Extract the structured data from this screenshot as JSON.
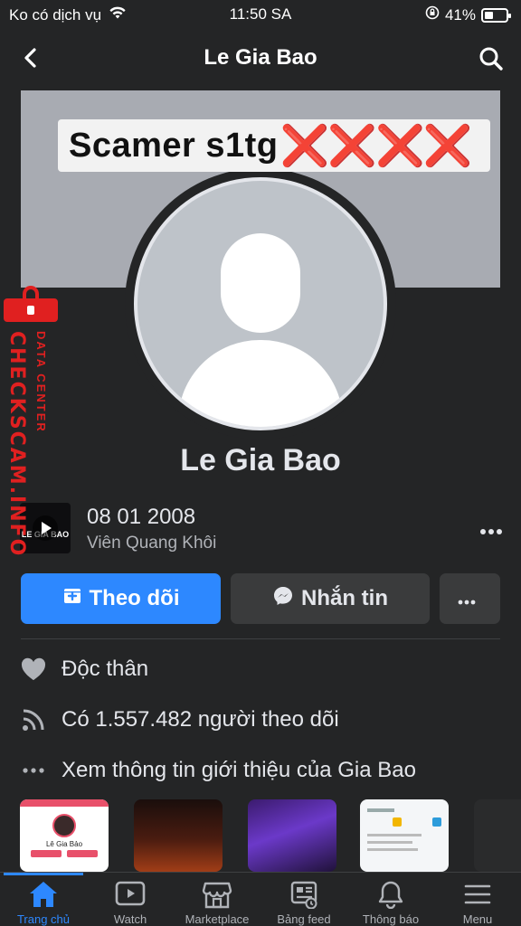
{
  "status_bar": {
    "carrier": "Ko có dịch vụ",
    "time": "11:50 SA",
    "battery": "41%",
    "battery_level": 0.41
  },
  "nav": {
    "title": "Le Gia Bao"
  },
  "banner": {
    "text": "Scamer s1tg",
    "marks": "❌❌❌❌"
  },
  "watermark": {
    "main": "CHECKSCAM.INFO",
    "sub": "DATA CENTER"
  },
  "profile": {
    "name": "Le Gia Bao"
  },
  "work": {
    "thumb_text": "LE GIA BAO",
    "date": "08 01 2008",
    "subtitle": "Viên Quang Khôi"
  },
  "actions": {
    "follow_label": "Theo dõi",
    "message_label": "Nhắn tin"
  },
  "info": {
    "relationship": "Độc thân",
    "followers": "Có 1.557.482 người theo dõi",
    "see_about": "Xem thông tin giới thiệu của Gia Bao"
  },
  "photos": {
    "first_caption": "Lê Gia Bảo"
  },
  "tabs": [
    {
      "label": "Trang chủ",
      "icon": "home-icon"
    },
    {
      "label": "Watch",
      "icon": "watch-icon"
    },
    {
      "label": "Marketplace",
      "icon": "marketplace-icon"
    },
    {
      "label": "Bảng feed",
      "icon": "feed-icon"
    },
    {
      "label": "Thông báo",
      "icon": "bell-icon"
    },
    {
      "label": "Menu",
      "icon": "menu-icon"
    }
  ],
  "colors": {
    "background": "#242526",
    "accent": "#2d88ff",
    "secondary_button": "#3a3b3c",
    "watermark": "#e02020"
  }
}
